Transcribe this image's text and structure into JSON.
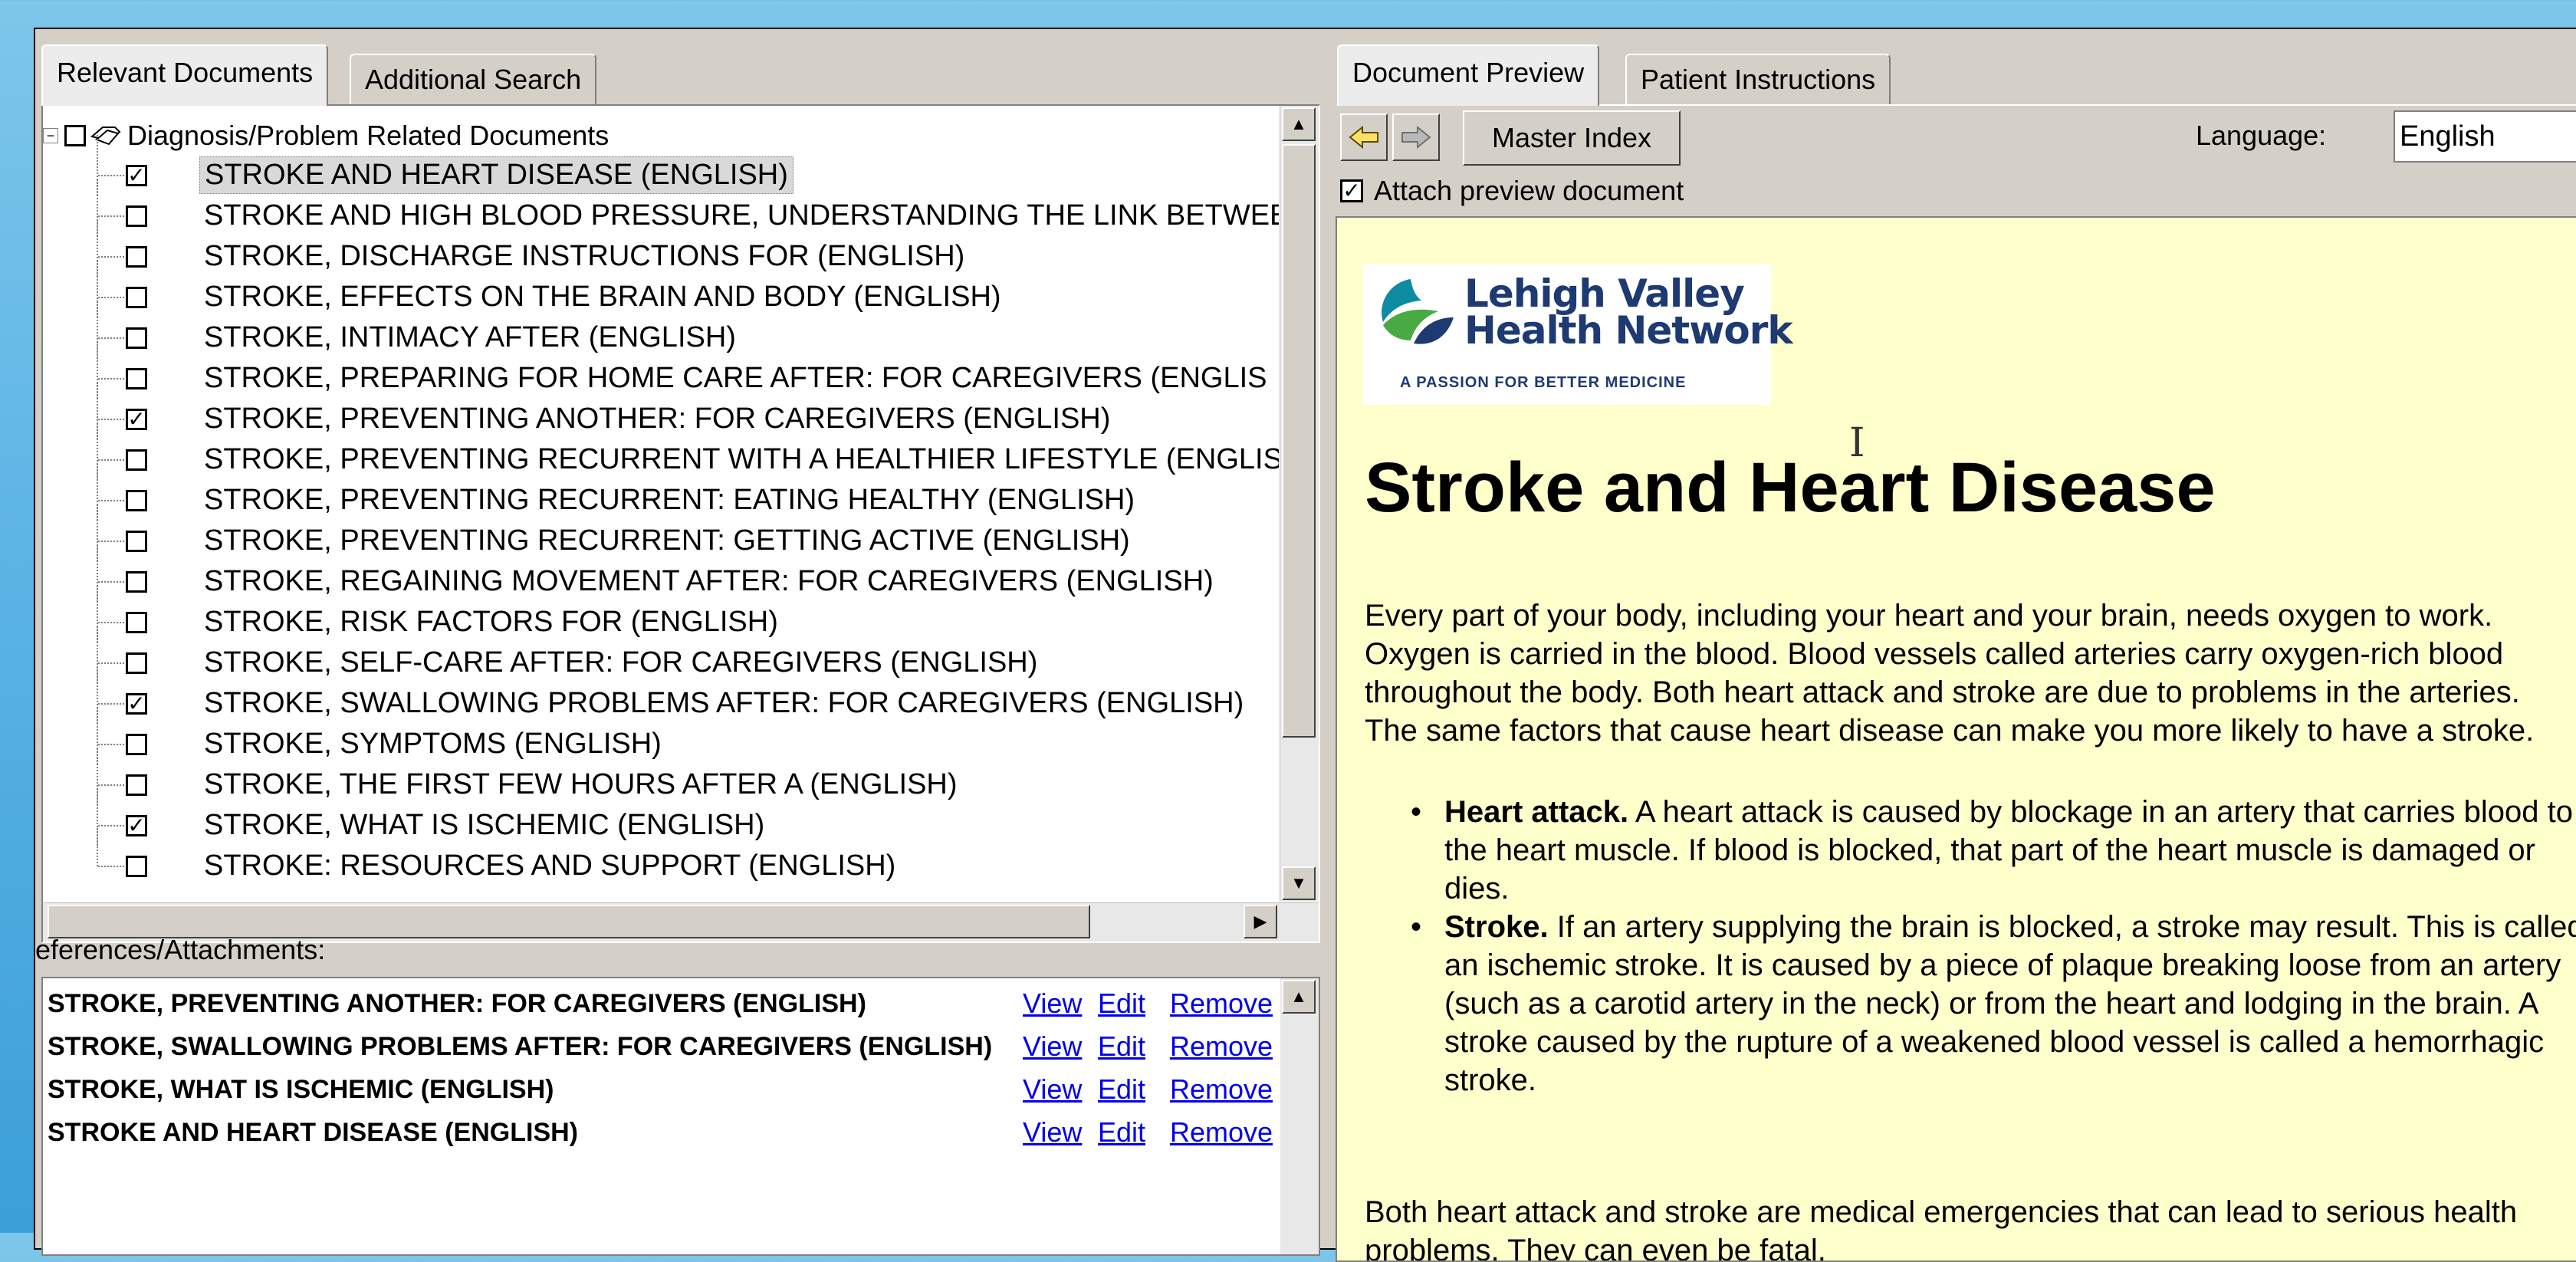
{
  "left_tabs": [
    {
      "label": "Relevant Documents",
      "active": true
    },
    {
      "label": "Additional Search",
      "active": false
    }
  ],
  "tree": {
    "root_label": "Diagnosis/Problem Related Documents",
    "items": [
      {
        "label": "STROKE AND HEART DISEASE (ENGLISH)",
        "checked": true,
        "selected": true
      },
      {
        "label": "STROKE AND HIGH BLOOD PRESSURE, UNDERSTANDING THE LINK BETWEE",
        "checked": false
      },
      {
        "label": "STROKE, DISCHARGE INSTRUCTIONS FOR (ENGLISH)",
        "checked": false
      },
      {
        "label": "STROKE, EFFECTS ON THE BRAIN AND BODY (ENGLISH)",
        "checked": false
      },
      {
        "label": "STROKE, INTIMACY AFTER (ENGLISH)",
        "checked": false
      },
      {
        "label": "STROKE, PREPARING FOR HOME CARE AFTER: FOR CAREGIVERS (ENGLIS",
        "checked": false
      },
      {
        "label": "STROKE, PREVENTING ANOTHER: FOR CAREGIVERS (ENGLISH)",
        "checked": true
      },
      {
        "label": "STROKE, PREVENTING RECURRENT WITH A HEALTHIER LIFESTYLE (ENGLIS",
        "checked": false
      },
      {
        "label": "STROKE, PREVENTING RECURRENT: EATING HEALTHY (ENGLISH)",
        "checked": false
      },
      {
        "label": "STROKE, PREVENTING RECURRENT: GETTING ACTIVE (ENGLISH)",
        "checked": false
      },
      {
        "label": "STROKE, REGAINING MOVEMENT AFTER: FOR CAREGIVERS (ENGLISH)",
        "checked": false
      },
      {
        "label": "STROKE, RISK FACTORS FOR (ENGLISH)",
        "checked": false
      },
      {
        "label": "STROKE, SELF-CARE AFTER: FOR CAREGIVERS (ENGLISH)",
        "checked": false
      },
      {
        "label": "STROKE, SWALLOWING PROBLEMS AFTER: FOR CAREGIVERS (ENGLISH)",
        "checked": true
      },
      {
        "label": "STROKE, SYMPTOMS (ENGLISH)",
        "checked": false
      },
      {
        "label": "STROKE, THE FIRST FEW HOURS AFTER A (ENGLISH)",
        "checked": false
      },
      {
        "label": "STROKE, WHAT IS ISCHEMIC (ENGLISH)",
        "checked": true
      },
      {
        "label": "STROKE: RESOURCES AND SUPPORT (ENGLISH)",
        "checked": false
      }
    ]
  },
  "references": {
    "label": "eferences/Attachments:",
    "rows": [
      {
        "title": "STROKE, PREVENTING ANOTHER: FOR CAREGIVERS (ENGLISH)"
      },
      {
        "title": "STROKE, SWALLOWING PROBLEMS AFTER: FOR CAREGIVERS (ENGLISH)"
      },
      {
        "title": "STROKE, WHAT IS ISCHEMIC (ENGLISH)"
      },
      {
        "title": "STROKE AND HEART DISEASE (ENGLISH)"
      }
    ],
    "view_label": "View",
    "edit_label": "Edit",
    "remove_label": "Remove"
  },
  "right_tabs": [
    {
      "label": "Document Preview",
      "active": true
    },
    {
      "label": "Patient Instructions",
      "active": false
    }
  ],
  "toolbar": {
    "back_icon": "arrow-left-icon",
    "forward_icon": "arrow-right-icon",
    "master_index_label": "Master Index",
    "language_label": "Language:",
    "language_value": "English"
  },
  "attach": {
    "label": "Attach preview document",
    "checked": true
  },
  "preview": {
    "logo_line1": "Lehigh Valley",
    "logo_line2": "Health Network",
    "logo_tagline": "A PASSION FOR BETTER MEDICINE",
    "title": "Stroke and Heart Disease",
    "intro": "Every part of your body, including your heart and your brain, needs oxygen to work. Oxygen is carried in the blood. Blood vessels called arteries carry oxygen-rich blood throughout the body. Both heart attack and stroke are due to problems in the arteries. The same factors that cause heart disease can make you more likely to have a stroke.",
    "bullets": [
      {
        "term": "Heart attack.",
        "text": " A heart attack is caused by blockage in an artery that carries blood to the heart muscle. If blood is blocked, that part of the heart muscle is damaged or dies."
      },
      {
        "term": "Stroke.",
        "text": " If an artery supplying the brain is blocked, a stroke may result. This is called an ischemic stroke. It is caused by a piece of plaque breaking loose from an artery (such as a carotid artery in the neck) or from the heart and lodging in the brain. A stroke caused by the rupture of a weakened blood vessel is called a hemorrhagic stroke."
      }
    ],
    "closing": "Both heart attack and stroke are medical emergencies that can lead to serious health problems. They can even be fatal."
  },
  "colors": {
    "desktop": "#5fb6e6",
    "preview_bg": "#ffffcc",
    "link": "#0000ee",
    "logo_blue": "#1d3a72",
    "logo_green": "#49a942",
    "logo_teal": "#0d8ba0"
  }
}
